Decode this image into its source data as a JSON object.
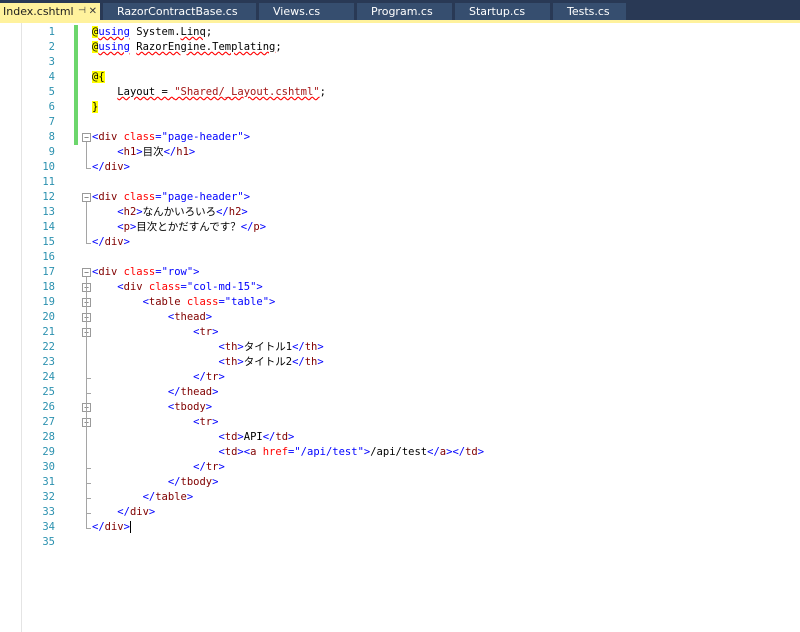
{
  "tabs": [
    {
      "label": "Index.cshtml",
      "active": true
    },
    {
      "label": "RazorContractBase.cs",
      "active": false
    },
    {
      "label": "Views.cs",
      "active": false
    },
    {
      "label": "Program.cs",
      "active": false
    },
    {
      "label": "Startup.cs",
      "active": false
    },
    {
      "label": "Tests.cs",
      "active": false
    }
  ],
  "icons": {
    "pin": "pin-icon",
    "close": "close-icon"
  },
  "colors": {
    "tabbar": "#293955",
    "active_tab": "#fff29d",
    "line_number": "#2b91af",
    "tag": "#0000ff",
    "element": "#800000",
    "attribute": "#ff0000",
    "razor_at": "#ffff00",
    "change_bar": "#6cd66c"
  },
  "lines": [
    {
      "n": "1",
      "changed": true,
      "tokens": [
        {
          "t": "@",
          "c": "at"
        },
        {
          "t": "using",
          "c": "kw sq"
        },
        {
          "t": " System.",
          "c": "cs"
        },
        {
          "t": "Linq",
          "c": "cs sq"
        },
        {
          "t": ";",
          "c": "cs"
        }
      ]
    },
    {
      "n": "2",
      "changed": true,
      "tokens": [
        {
          "t": "@",
          "c": "at"
        },
        {
          "t": "using",
          "c": "kw sq"
        },
        {
          "t": " ",
          "c": "cs"
        },
        {
          "t": "RazorEngine.Templating",
          "c": "cs sq"
        },
        {
          "t": ";",
          "c": "cs"
        }
      ]
    },
    {
      "n": "3",
      "changed": true,
      "tokens": []
    },
    {
      "n": "4",
      "changed": true,
      "tokens": [
        {
          "t": "@{",
          "c": "at"
        }
      ]
    },
    {
      "n": "5",
      "changed": true,
      "tokens": [
        {
          "t": "    ",
          "c": "cs"
        },
        {
          "t": "Layout = ",
          "c": "cs sq"
        },
        {
          "t": "\"Shared/_Layout.cshtml\"",
          "c": "csstr sq"
        },
        {
          "t": ";",
          "c": "cs"
        }
      ]
    },
    {
      "n": "6",
      "changed": true,
      "tokens": [
        {
          "t": "}",
          "c": "at"
        }
      ]
    },
    {
      "n": "7",
      "changed": true,
      "tokens": []
    },
    {
      "n": "8",
      "changed": true,
      "fold": true,
      "tokens": [
        {
          "t": "<",
          "c": "tag"
        },
        {
          "t": "div",
          "c": "name"
        },
        {
          "t": " ",
          "c": "txt"
        },
        {
          "t": "class",
          "c": "attr"
        },
        {
          "t": "=",
          "c": "tag"
        },
        {
          "t": "\"page-header\"",
          "c": "str"
        },
        {
          "t": ">",
          "c": "tag"
        }
      ]
    },
    {
      "n": "9",
      "tokens": [
        {
          "t": "    ",
          "c": "txt"
        },
        {
          "t": "<",
          "c": "tag"
        },
        {
          "t": "h1",
          "c": "name"
        },
        {
          "t": ">",
          "c": "tag"
        },
        {
          "t": "目次",
          "c": "txt"
        },
        {
          "t": "</",
          "c": "tag"
        },
        {
          "t": "h1",
          "c": "name"
        },
        {
          "t": ">",
          "c": "tag"
        }
      ]
    },
    {
      "n": "10",
      "tokens": [
        {
          "t": "</",
          "c": "tag"
        },
        {
          "t": "div",
          "c": "name"
        },
        {
          "t": ">",
          "c": "tag"
        }
      ]
    },
    {
      "n": "11",
      "tokens": []
    },
    {
      "n": "12",
      "fold": true,
      "tokens": [
        {
          "t": "<",
          "c": "tag"
        },
        {
          "t": "div",
          "c": "name"
        },
        {
          "t": " ",
          "c": "txt"
        },
        {
          "t": "class",
          "c": "attr"
        },
        {
          "t": "=",
          "c": "tag"
        },
        {
          "t": "\"page-header\"",
          "c": "str"
        },
        {
          "t": ">",
          "c": "tag"
        }
      ]
    },
    {
      "n": "13",
      "tokens": [
        {
          "t": "    ",
          "c": "txt"
        },
        {
          "t": "<",
          "c": "tag"
        },
        {
          "t": "h2",
          "c": "name"
        },
        {
          "t": ">",
          "c": "tag"
        },
        {
          "t": "なんかいろいろ",
          "c": "txt"
        },
        {
          "t": "</",
          "c": "tag"
        },
        {
          "t": "h2",
          "c": "name"
        },
        {
          "t": ">",
          "c": "tag"
        }
      ]
    },
    {
      "n": "14",
      "tokens": [
        {
          "t": "    ",
          "c": "txt"
        },
        {
          "t": "<",
          "c": "tag"
        },
        {
          "t": "p",
          "c": "name"
        },
        {
          "t": ">",
          "c": "tag"
        },
        {
          "t": "目次とかだすんです？",
          "c": "txt"
        },
        {
          "t": "</",
          "c": "tag"
        },
        {
          "t": "p",
          "c": "name"
        },
        {
          "t": ">",
          "c": "tag"
        }
      ]
    },
    {
      "n": "15",
      "tokens": [
        {
          "t": "</",
          "c": "tag"
        },
        {
          "t": "div",
          "c": "name"
        },
        {
          "t": ">",
          "c": "tag"
        }
      ]
    },
    {
      "n": "16",
      "tokens": []
    },
    {
      "n": "17",
      "fold": true,
      "tokens": [
        {
          "t": "<",
          "c": "tag"
        },
        {
          "t": "div",
          "c": "name"
        },
        {
          "t": " ",
          "c": "txt"
        },
        {
          "t": "class",
          "c": "attr"
        },
        {
          "t": "=",
          "c": "tag"
        },
        {
          "t": "\"row\"",
          "c": "str"
        },
        {
          "t": ">",
          "c": "tag"
        }
      ]
    },
    {
      "n": "18",
      "fold": true,
      "tokens": [
        {
          "t": "    ",
          "c": "txt"
        },
        {
          "t": "<",
          "c": "tag"
        },
        {
          "t": "div",
          "c": "name"
        },
        {
          "t": " ",
          "c": "txt"
        },
        {
          "t": "class",
          "c": "attr"
        },
        {
          "t": "=",
          "c": "tag"
        },
        {
          "t": "\"col-md-15\"",
          "c": "str"
        },
        {
          "t": ">",
          "c": "tag"
        }
      ]
    },
    {
      "n": "19",
      "fold": true,
      "tokens": [
        {
          "t": "        ",
          "c": "txt"
        },
        {
          "t": "<",
          "c": "tag"
        },
        {
          "t": "table",
          "c": "name"
        },
        {
          "t": " ",
          "c": "txt"
        },
        {
          "t": "class",
          "c": "attr"
        },
        {
          "t": "=",
          "c": "tag"
        },
        {
          "t": "\"table\"",
          "c": "str"
        },
        {
          "t": ">",
          "c": "tag"
        }
      ]
    },
    {
      "n": "20",
      "fold": true,
      "tokens": [
        {
          "t": "            ",
          "c": "txt"
        },
        {
          "t": "<",
          "c": "tag"
        },
        {
          "t": "thead",
          "c": "name"
        },
        {
          "t": ">",
          "c": "tag"
        }
      ]
    },
    {
      "n": "21",
      "fold": true,
      "tokens": [
        {
          "t": "                ",
          "c": "txt"
        },
        {
          "t": "<",
          "c": "tag"
        },
        {
          "t": "tr",
          "c": "name"
        },
        {
          "t": ">",
          "c": "tag"
        }
      ]
    },
    {
      "n": "22",
      "tokens": [
        {
          "t": "                    ",
          "c": "txt"
        },
        {
          "t": "<",
          "c": "tag"
        },
        {
          "t": "th",
          "c": "name"
        },
        {
          "t": ">",
          "c": "tag"
        },
        {
          "t": "タイトル1",
          "c": "txt"
        },
        {
          "t": "</",
          "c": "tag"
        },
        {
          "t": "th",
          "c": "name"
        },
        {
          "t": ">",
          "c": "tag"
        }
      ]
    },
    {
      "n": "23",
      "tokens": [
        {
          "t": "                    ",
          "c": "txt"
        },
        {
          "t": "<",
          "c": "tag"
        },
        {
          "t": "th",
          "c": "name"
        },
        {
          "t": ">",
          "c": "tag"
        },
        {
          "t": "タイトル2",
          "c": "txt"
        },
        {
          "t": "</",
          "c": "tag"
        },
        {
          "t": "th",
          "c": "name"
        },
        {
          "t": ">",
          "c": "tag"
        }
      ]
    },
    {
      "n": "24",
      "tokens": [
        {
          "t": "                ",
          "c": "txt"
        },
        {
          "t": "</",
          "c": "tag"
        },
        {
          "t": "tr",
          "c": "name"
        },
        {
          "t": ">",
          "c": "tag"
        }
      ]
    },
    {
      "n": "25",
      "tokens": [
        {
          "t": "            ",
          "c": "txt"
        },
        {
          "t": "</",
          "c": "tag"
        },
        {
          "t": "thead",
          "c": "name"
        },
        {
          "t": ">",
          "c": "tag"
        }
      ]
    },
    {
      "n": "26",
      "fold": true,
      "tokens": [
        {
          "t": "            ",
          "c": "txt"
        },
        {
          "t": "<",
          "c": "tag"
        },
        {
          "t": "tbody",
          "c": "name"
        },
        {
          "t": ">",
          "c": "tag"
        }
      ]
    },
    {
      "n": "27",
      "fold": true,
      "tokens": [
        {
          "t": "                ",
          "c": "txt"
        },
        {
          "t": "<",
          "c": "tag"
        },
        {
          "t": "tr",
          "c": "name"
        },
        {
          "t": ">",
          "c": "tag"
        }
      ]
    },
    {
      "n": "28",
      "tokens": [
        {
          "t": "                    ",
          "c": "txt"
        },
        {
          "t": "<",
          "c": "tag"
        },
        {
          "t": "td",
          "c": "name"
        },
        {
          "t": ">",
          "c": "tag"
        },
        {
          "t": "API",
          "c": "txt"
        },
        {
          "t": "</",
          "c": "tag"
        },
        {
          "t": "td",
          "c": "name"
        },
        {
          "t": ">",
          "c": "tag"
        }
      ]
    },
    {
      "n": "29",
      "tokens": [
        {
          "t": "                    ",
          "c": "txt"
        },
        {
          "t": "<",
          "c": "tag"
        },
        {
          "t": "td",
          "c": "name"
        },
        {
          "t": ">",
          "c": "tag"
        },
        {
          "t": "<",
          "c": "tag"
        },
        {
          "t": "a",
          "c": "name"
        },
        {
          "t": " ",
          "c": "txt"
        },
        {
          "t": "href",
          "c": "attr"
        },
        {
          "t": "=",
          "c": "tag"
        },
        {
          "t": "\"/api/test\"",
          "c": "str"
        },
        {
          "t": ">",
          "c": "tag"
        },
        {
          "t": "/api/test",
          "c": "txt"
        },
        {
          "t": "</",
          "c": "tag"
        },
        {
          "t": "a",
          "c": "name"
        },
        {
          "t": ">",
          "c": "tag"
        },
        {
          "t": "</",
          "c": "tag"
        },
        {
          "t": "td",
          "c": "name"
        },
        {
          "t": ">",
          "c": "tag"
        }
      ]
    },
    {
      "n": "30",
      "tokens": [
        {
          "t": "                ",
          "c": "txt"
        },
        {
          "t": "</",
          "c": "tag"
        },
        {
          "t": "tr",
          "c": "name"
        },
        {
          "t": ">",
          "c": "tag"
        }
      ]
    },
    {
      "n": "31",
      "tokens": [
        {
          "t": "            ",
          "c": "txt"
        },
        {
          "t": "</",
          "c": "tag"
        },
        {
          "t": "tbody",
          "c": "name"
        },
        {
          "t": ">",
          "c": "tag"
        }
      ]
    },
    {
      "n": "32",
      "tokens": [
        {
          "t": "        ",
          "c": "txt"
        },
        {
          "t": "</",
          "c": "tag"
        },
        {
          "t": "table",
          "c": "name"
        },
        {
          "t": ">",
          "c": "tag"
        }
      ]
    },
    {
      "n": "33",
      "tokens": [
        {
          "t": "    ",
          "c": "txt"
        },
        {
          "t": "</",
          "c": "tag"
        },
        {
          "t": "div",
          "c": "name"
        },
        {
          "t": ">",
          "c": "tag"
        }
      ]
    },
    {
      "n": "34",
      "caret": true,
      "tokens": [
        {
          "t": "</",
          "c": "tag"
        },
        {
          "t": "div",
          "c": "name"
        },
        {
          "t": ">",
          "c": "tag"
        }
      ]
    },
    {
      "n": "35",
      "tokens": []
    }
  ]
}
